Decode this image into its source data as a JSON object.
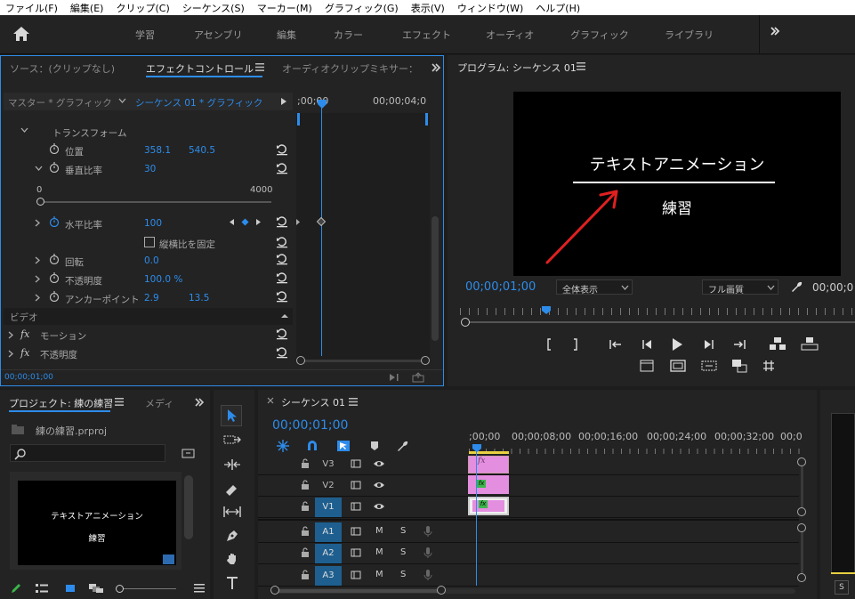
{
  "menu": [
    "ファイル(F)",
    "編集(E)",
    "クリップ(C)",
    "シーケンス(S)",
    "マーカー(M)",
    "グラフィック(G)",
    "表示(V)",
    "ウィンドウ(W)",
    "ヘルプ(H)"
  ],
  "workspaces": [
    "学習",
    "アセンブリ",
    "編集",
    "カラー",
    "エフェクト",
    "オーディオ",
    "グラフィック",
    "ライブラリ"
  ],
  "effect_panel": {
    "tab_source": "ソース：(クリップなし)",
    "tab_effect": "エフェクトコントロール",
    "tab_audio": "オーディオクリップミキサー：",
    "master": "マスター * グラフィック",
    "sequence": "シーケンス 01 * グラフィック",
    "time_start": ";00;00",
    "time_end": "00;00;04;0",
    "transform": "トランスフォーム",
    "position_label": "位置",
    "position_x": "358.1",
    "position_y": "540.5",
    "vscale_label": "垂直比率",
    "vscale_value": "30",
    "slider_min": "0",
    "slider_max": "4000",
    "slider_level": 0.0075,
    "hscale_label": "水平比率",
    "hscale_value": "100",
    "uniform_label": "縦横比を固定",
    "rotation_label": "回転",
    "rotation_value": "0.0",
    "opacity_label": "不透明度",
    "opacity_value": "100.0 %",
    "anchor_label": "アンカーポイント",
    "anchor_x": "2.9",
    "anchor_y": "13.5",
    "video_header": "ビデオ",
    "motion_label": "モーション",
    "opacity2_label": "不透明度",
    "footer_time": "00;00;01;00"
  },
  "program": {
    "title": "プログラム: シーケンス 01",
    "text_main": "テキストアニメーション",
    "text_sub": "練習",
    "timecode": "00;00;01;00",
    "zoom": "全体表示",
    "quality": "フル画質",
    "timecode_right": "00;00;0"
  },
  "project": {
    "tab_project": "プロジェクト: 練の練習",
    "tab_media": "メディ",
    "file": "練の練習.prproj",
    "thumb_main": "テキストアニメーション",
    "thumb_sub": "練習"
  },
  "timeline": {
    "title": "シーケンス 01",
    "timecode": "00;00;01;00",
    "ruler": [
      ";00;00",
      "00;00;08;00",
      "00;00;16;00",
      "00;00;24;00",
      "00;00;32;00",
      "00;0"
    ],
    "tracks": [
      {
        "name": "V3",
        "type": "video"
      },
      {
        "name": "V2",
        "type": "video"
      },
      {
        "name": "V1",
        "type": "video"
      },
      {
        "name": "A1",
        "type": "audio"
      },
      {
        "name": "A2",
        "type": "audio"
      },
      {
        "name": "A3",
        "type": "audio"
      }
    ],
    "fx_label": "fx",
    "m_label": "M",
    "s_label": "S"
  },
  "meter": {
    "s_label": "S"
  },
  "colors": {
    "accent": "#2d8ceb",
    "clip": "#e48ee0",
    "arrow": "#e02020"
  }
}
